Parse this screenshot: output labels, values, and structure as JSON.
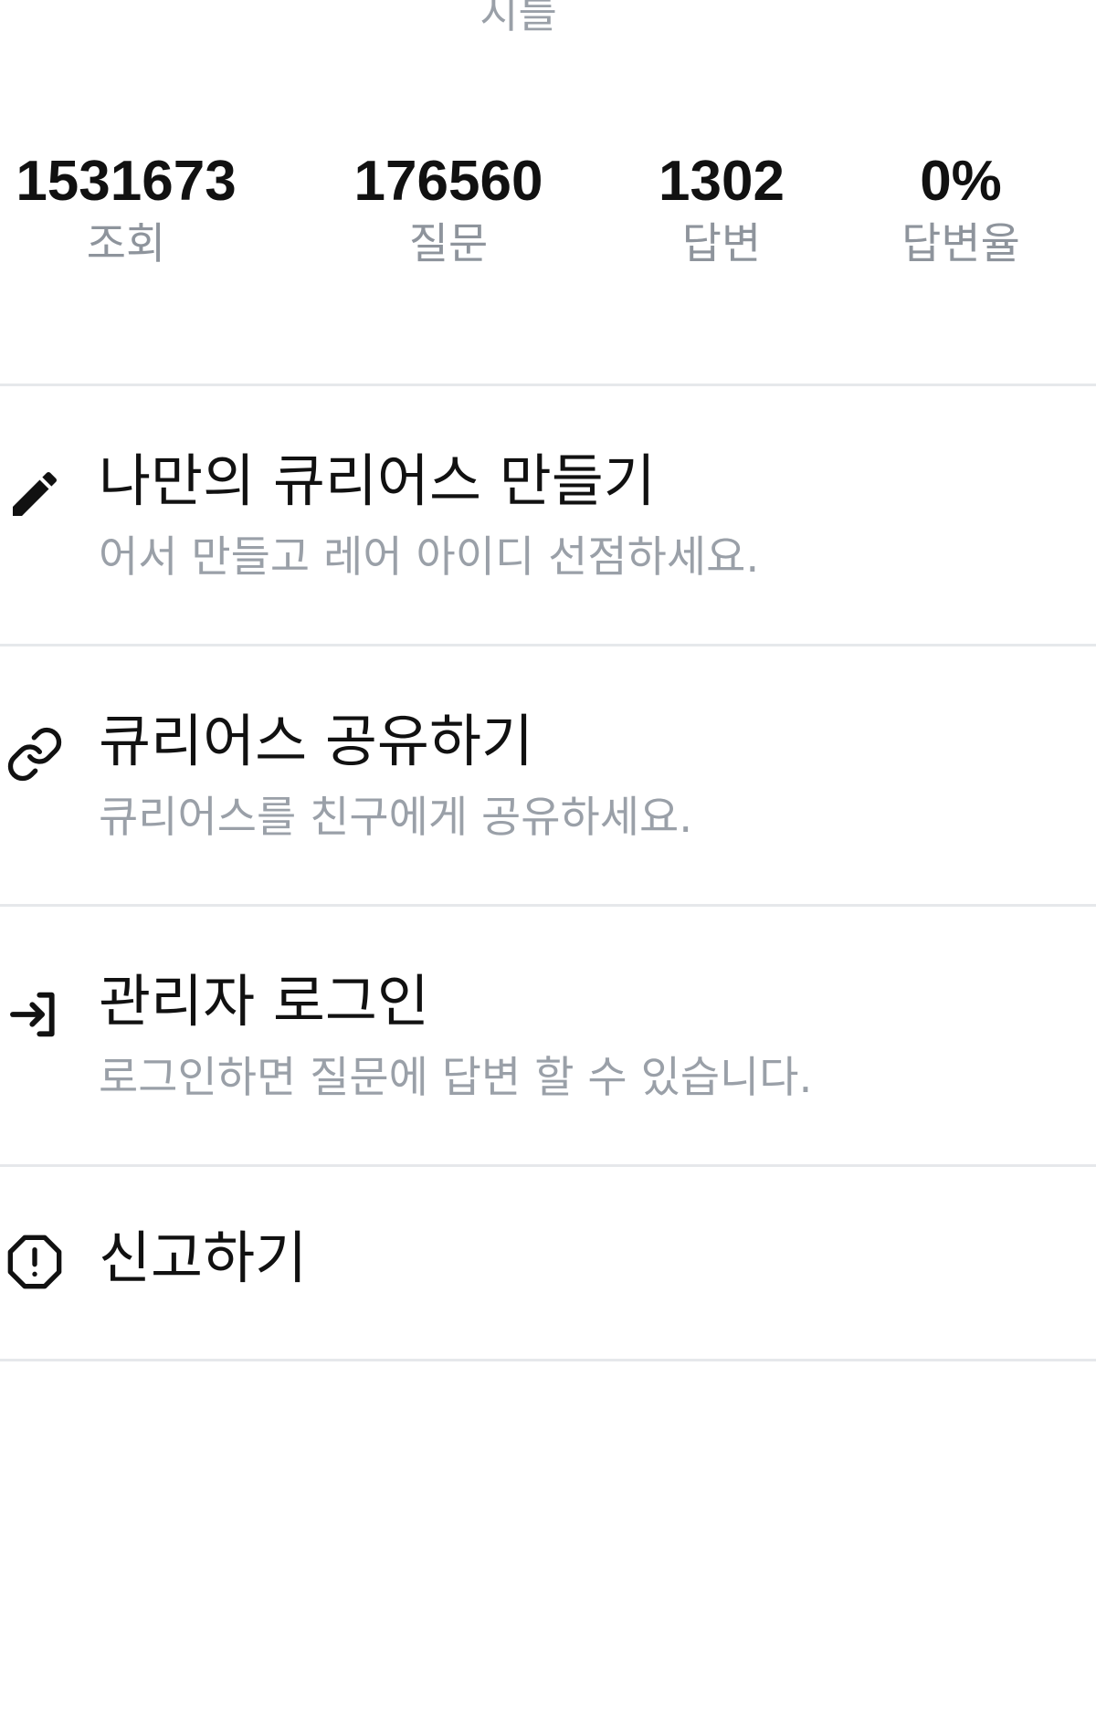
{
  "header": {
    "title_partial": "지를"
  },
  "stats": {
    "views": {
      "value": "1531673",
      "label": "조회"
    },
    "questions": {
      "value": "176560",
      "label": "질문"
    },
    "answers": {
      "value": "1302",
      "label": "답변"
    },
    "answer_rate": {
      "value": "0%",
      "label": "답변율"
    }
  },
  "menu": {
    "create": {
      "icon": "pencil-icon",
      "title": "나만의 큐리어스 만들기",
      "description": "어서 만들고 레어 아이디 선점하세요."
    },
    "share": {
      "icon": "link-icon",
      "title": "큐리어스 공유하기",
      "description": "큐리어스를 친구에게 공유하세요."
    },
    "admin_login": {
      "icon": "login-icon",
      "title": "관리자 로그인",
      "description": "로그인하면 질문에 답변 할 수 있습니다."
    },
    "report": {
      "icon": "alert-octagon-icon",
      "title": "신고하기"
    }
  },
  "colors": {
    "text_primary": "#111111",
    "text_secondary": "#9aa0a8",
    "divider": "#e6e8eb",
    "background": "#ffffff"
  }
}
